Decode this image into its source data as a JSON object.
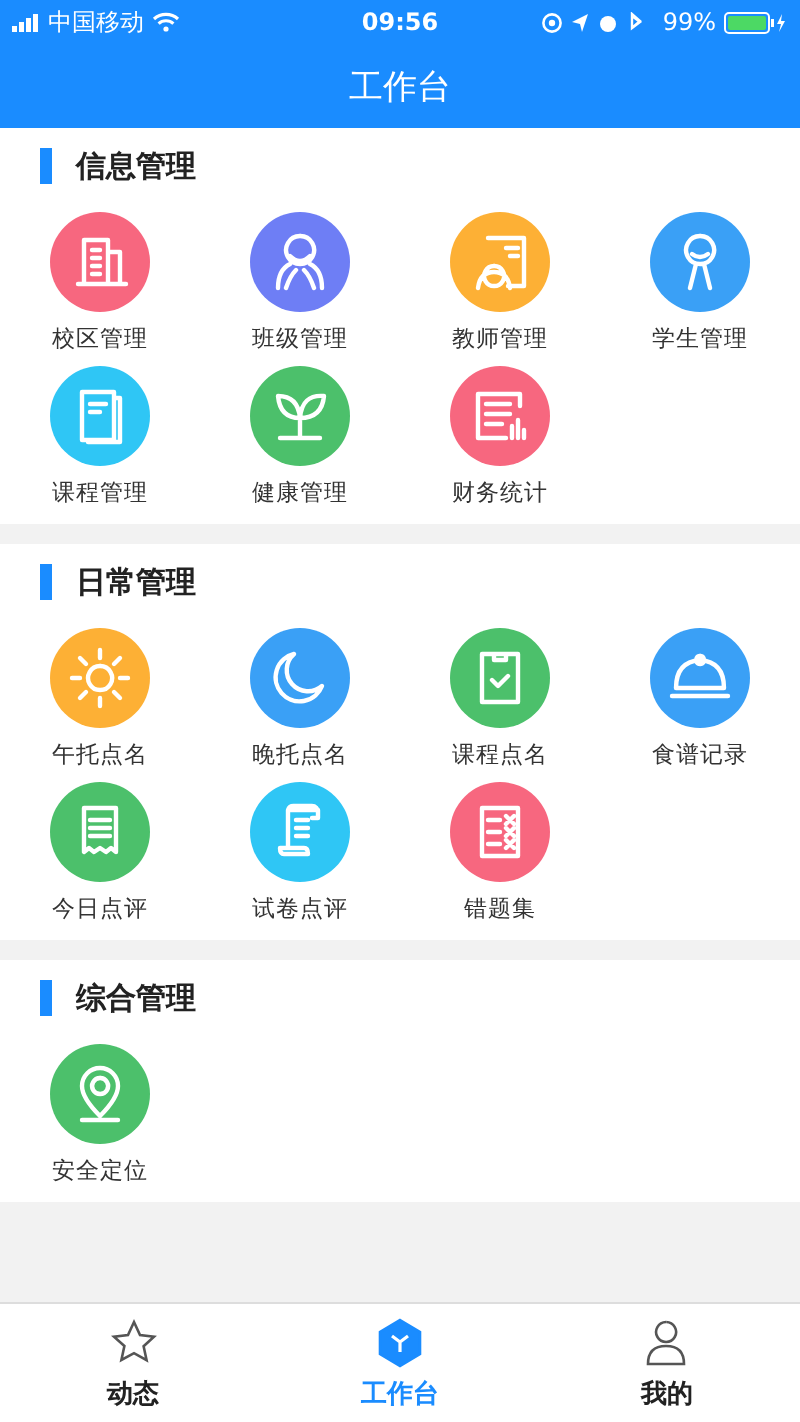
{
  "status_bar": {
    "carrier": "中国移动",
    "time": "09:56",
    "battery": "99%"
  },
  "title": "工作台",
  "sections": [
    {
      "title": "信息管理",
      "items": [
        {
          "label": "校区管理",
          "kind": "building",
          "color": "#f7677f"
        },
        {
          "label": "班级管理",
          "kind": "group",
          "color": "#6e7ef5"
        },
        {
          "label": "教师管理",
          "kind": "teacher",
          "color": "#fdb035"
        },
        {
          "label": "学生管理",
          "kind": "student",
          "color": "#3aa0f6"
        },
        {
          "label": "课程管理",
          "kind": "book",
          "color": "#2fc6f5"
        },
        {
          "label": "健康管理",
          "kind": "sprout",
          "color": "#4cc06b"
        },
        {
          "label": "财务统计",
          "kind": "report",
          "color": "#f7677f"
        }
      ]
    },
    {
      "title": "日常管理",
      "items": [
        {
          "label": "午托点名",
          "kind": "sun",
          "color": "#fdb035"
        },
        {
          "label": "晚托点名",
          "kind": "moon",
          "color": "#3aa0f6"
        },
        {
          "label": "课程点名",
          "kind": "clipboard",
          "color": "#4cc06b"
        },
        {
          "label": "食谱记录",
          "kind": "cloche",
          "color": "#3aa0f6"
        },
        {
          "label": "今日点评",
          "kind": "receipt",
          "color": "#4cc06b"
        },
        {
          "label": "试卷点评",
          "kind": "scroll",
          "color": "#2fc6f5"
        },
        {
          "label": "错题集",
          "kind": "notebook",
          "color": "#f7677f"
        }
      ]
    },
    {
      "title": "综合管理",
      "items": [
        {
          "label": "安全定位",
          "kind": "pin",
          "color": "#4cc06b"
        }
      ]
    }
  ],
  "tabs": [
    {
      "label": "动态",
      "kind": "star",
      "selected": false
    },
    {
      "label": "工作台",
      "kind": "hex",
      "selected": true
    },
    {
      "label": "我的",
      "kind": "person",
      "selected": false
    }
  ]
}
